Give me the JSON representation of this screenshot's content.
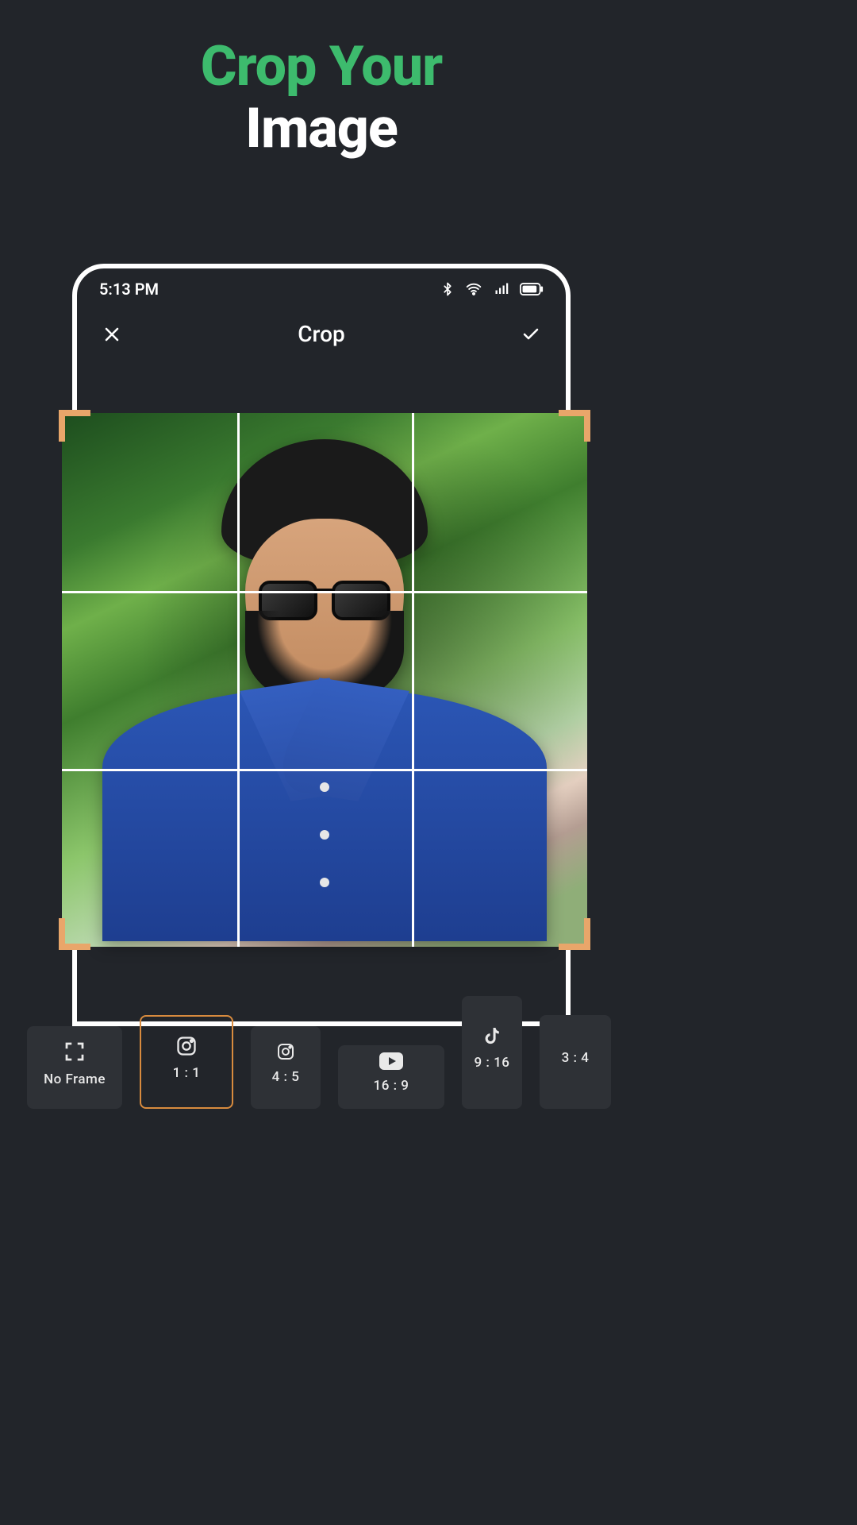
{
  "hero": {
    "line1": "Crop Your",
    "line2": "Image"
  },
  "statusbar": {
    "time": "5:13 PM",
    "icons": {
      "bluetooth": "bluetooth-icon",
      "wifi": "wifi-icon",
      "signal": "signal-icon",
      "battery": "battery-icon"
    }
  },
  "header": {
    "close": "close-icon",
    "title": "Crop",
    "confirm": "check-icon"
  },
  "canvas": {
    "grid": "3x3",
    "handle_color": "#e9a66a",
    "subject": "man-with-sunglasses-blue-shirt-green-foliage"
  },
  "ratios": [
    {
      "id": "noframe",
      "label": "No Frame",
      "icon": "fullscreen-icon",
      "selected": false
    },
    {
      "id": "1_1",
      "label": "1 : 1",
      "icon": "instagram-icon",
      "selected": true
    },
    {
      "id": "4_5",
      "label": "4 : 5",
      "icon": "instagram-icon",
      "selected": false
    },
    {
      "id": "16_9",
      "label": "16 : 9",
      "icon": "youtube-icon",
      "selected": false
    },
    {
      "id": "9_16",
      "label": "9 : 16",
      "icon": "tiktok-icon",
      "selected": false
    },
    {
      "id": "3_4",
      "label": "3 : 4",
      "icon": "",
      "selected": false
    }
  ],
  "colors": {
    "accent_green": "#3dbb6d",
    "handle_orange": "#e9a66a",
    "card": "#2e3136",
    "bg": "#22252a"
  }
}
